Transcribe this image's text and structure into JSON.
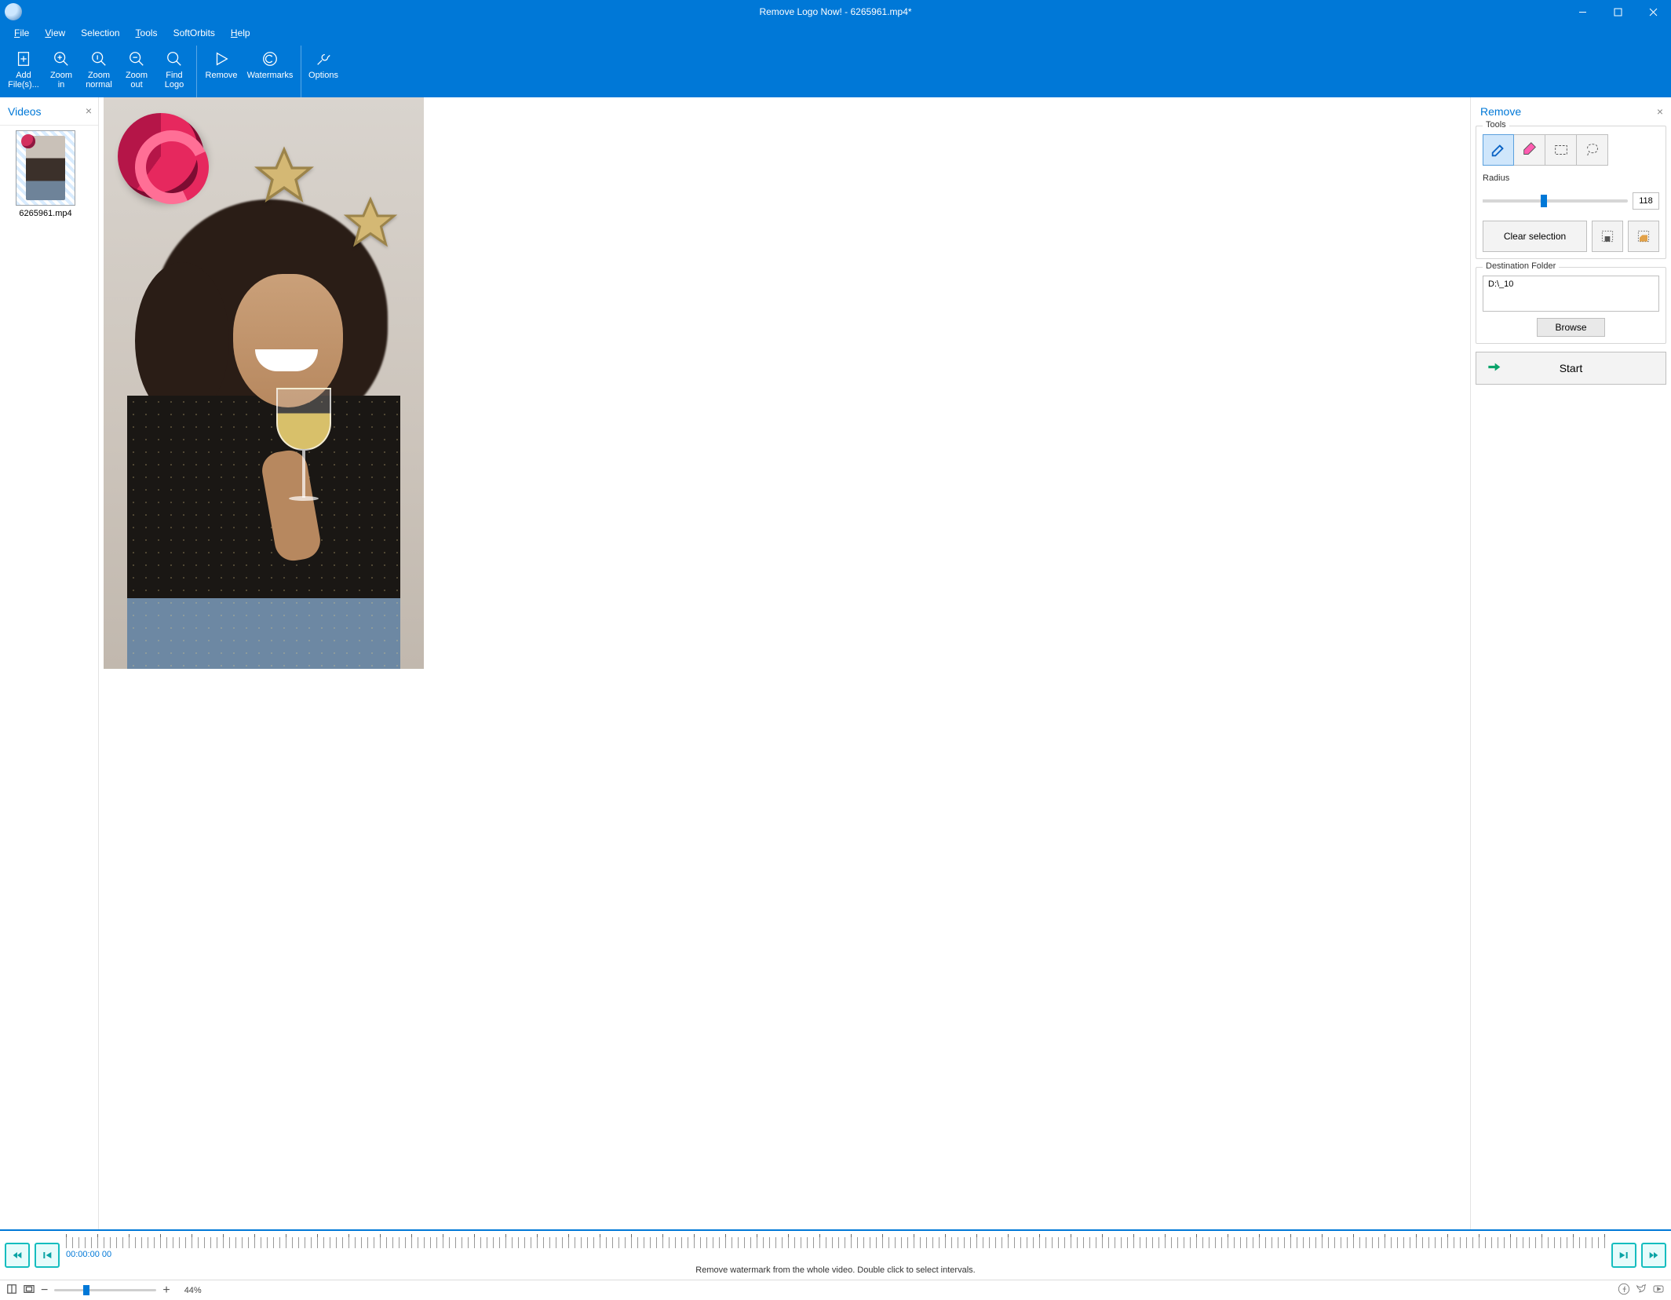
{
  "title": "Remove Logo Now! - 6265961.mp4*",
  "menu": {
    "file": "File",
    "view": "View",
    "selection": "Selection",
    "tools": "Tools",
    "softorbits": "SoftOrbits",
    "help": "Help"
  },
  "toolbar": {
    "add": "Add\nFile(s)...",
    "zoom_in": "Zoom\nin",
    "zoom_normal": "Zoom\nnormal",
    "zoom_out": "Zoom\nout",
    "find": "Find\nLogo",
    "remove": "Remove",
    "watermarks": "Watermarks",
    "options": "Options"
  },
  "left": {
    "title": "Videos",
    "thumb_name": "6265961.mp4"
  },
  "right": {
    "title": "Remove",
    "tools_legend": "Tools",
    "radius_label": "Radius",
    "radius_value": "118",
    "clear_selection": "Clear selection",
    "dest_legend": "Destination Folder",
    "dest_value": "D:\\_10",
    "browse": "Browse",
    "start": "Start"
  },
  "timeline": {
    "time": "00:00:00 00",
    "hint": "Remove watermark from the whole video. Double click to select intervals."
  },
  "status": {
    "zoom": "44%"
  }
}
